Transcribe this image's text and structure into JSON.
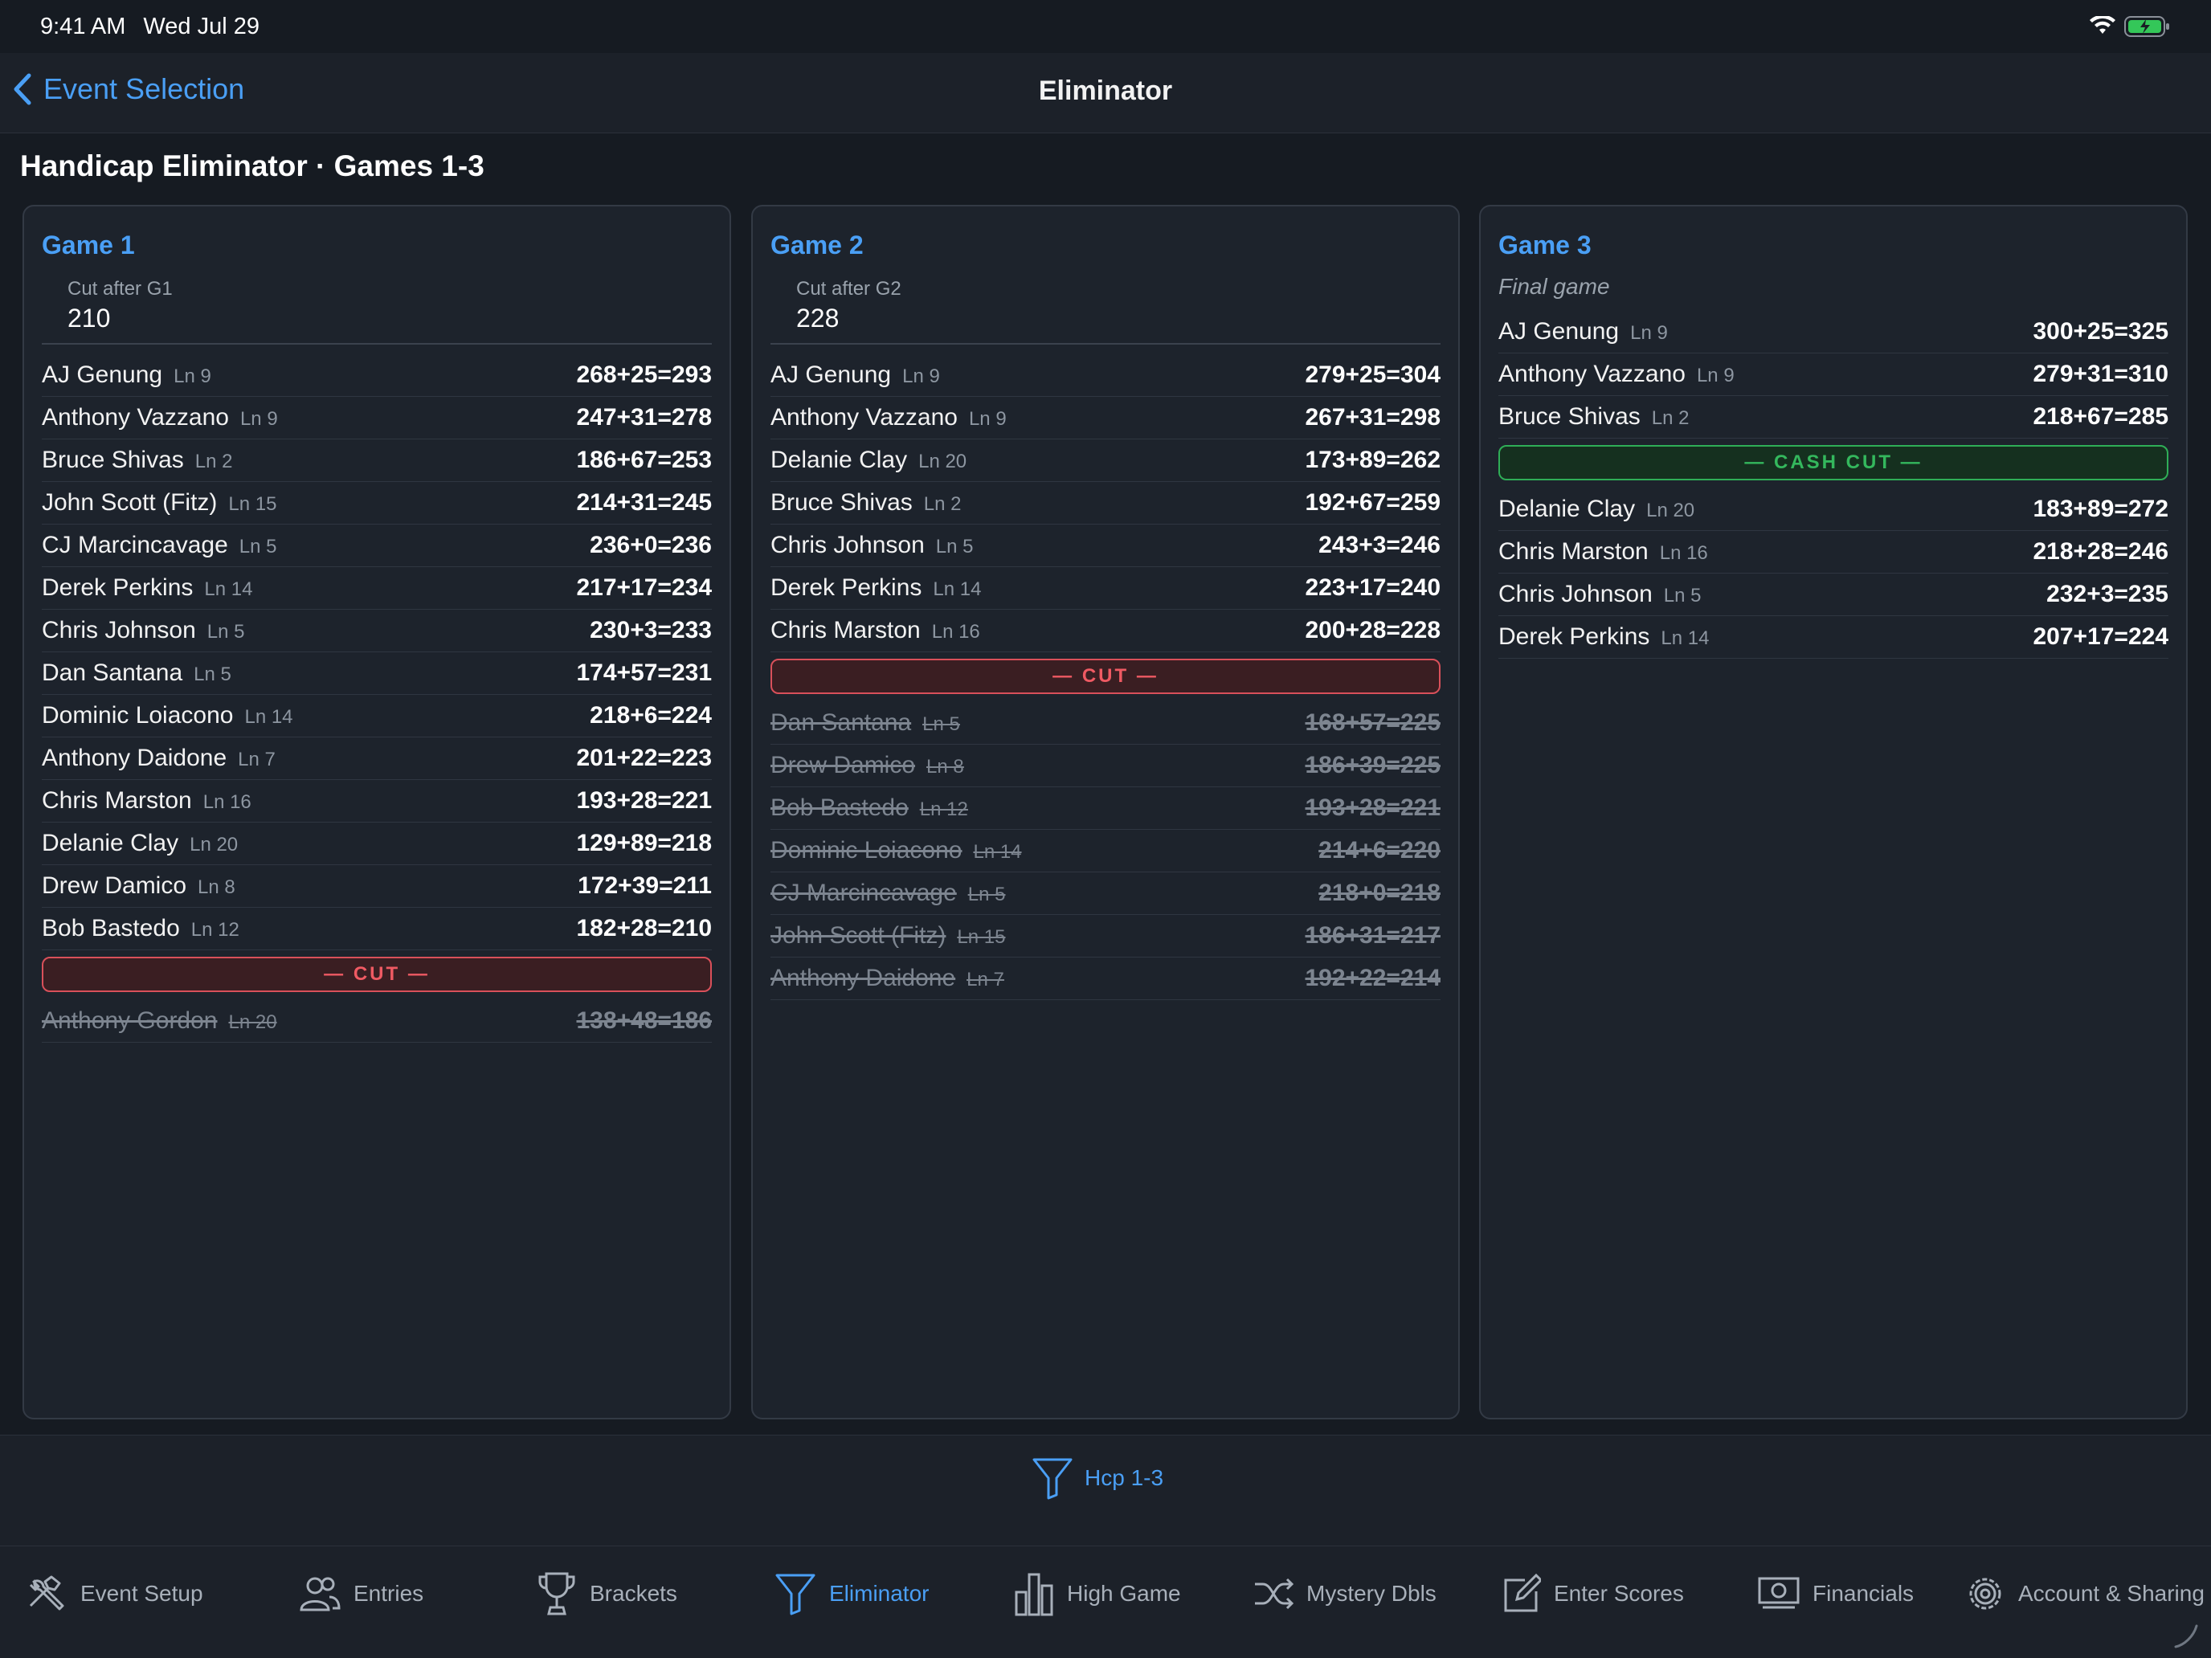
{
  "status": {
    "time": "9:41 AM",
    "date": "Wed Jul 29"
  },
  "nav": {
    "back_label": "Event Selection",
    "title": "Eliminator"
  },
  "heading": "Handicap Eliminator · Games 1-3",
  "colors": {
    "accent": "#4a9ff5",
    "cut": "#ef5a63",
    "cash": "#34b85d",
    "background": "#161b22"
  },
  "games": [
    {
      "title": "Game 1",
      "cut_label": "Cut after G1",
      "cut_value": "210",
      "divider_label": "— CUT —",
      "rows_in": [
        {
          "name": "AJ Genung",
          "lane": "Ln 9",
          "score": "268+25=293"
        },
        {
          "name": "Anthony Vazzano",
          "lane": "Ln 9",
          "score": "247+31=278"
        },
        {
          "name": "Bruce Shivas",
          "lane": "Ln 2",
          "score": "186+67=253"
        },
        {
          "name": "John Scott (Fitz)",
          "lane": "Ln 15",
          "score": "214+31=245"
        },
        {
          "name": "CJ Marcincavage",
          "lane": "Ln 5",
          "score": "236+0=236"
        },
        {
          "name": "Derek Perkins",
          "lane": "Ln 14",
          "score": "217+17=234"
        },
        {
          "name": "Chris Johnson",
          "lane": "Ln 5",
          "score": "230+3=233"
        },
        {
          "name": "Dan Santana",
          "lane": "Ln 5",
          "score": "174+57=231"
        },
        {
          "name": "Dominic Loiacono",
          "lane": "Ln 14",
          "score": "218+6=224"
        },
        {
          "name": "Anthony Daidone",
          "lane": "Ln 7",
          "score": "201+22=223"
        },
        {
          "name": "Chris Marston",
          "lane": "Ln 16",
          "score": "193+28=221"
        },
        {
          "name": "Delanie Clay",
          "lane": "Ln 20",
          "score": "129+89=218"
        },
        {
          "name": "Drew Damico",
          "lane": "Ln 8",
          "score": "172+39=211"
        },
        {
          "name": "Bob Bastedo",
          "lane": "Ln 12",
          "score": "182+28=210"
        }
      ],
      "rows_out": [
        {
          "name": "Anthony Gordon",
          "lane": "Ln 20",
          "score": "138+48=186"
        }
      ]
    },
    {
      "title": "Game 2",
      "cut_label": "Cut after G2",
      "cut_value": "228",
      "divider_label": "— CUT —",
      "rows_in": [
        {
          "name": "AJ Genung",
          "lane": "Ln 9",
          "score": "279+25=304"
        },
        {
          "name": "Anthony Vazzano",
          "lane": "Ln 9",
          "score": "267+31=298"
        },
        {
          "name": "Delanie Clay",
          "lane": "Ln 20",
          "score": "173+89=262"
        },
        {
          "name": "Bruce Shivas",
          "lane": "Ln 2",
          "score": "192+67=259"
        },
        {
          "name": "Chris Johnson",
          "lane": "Ln 5",
          "score": "243+3=246"
        },
        {
          "name": "Derek Perkins",
          "lane": "Ln 14",
          "score": "223+17=240"
        },
        {
          "name": "Chris Marston",
          "lane": "Ln 16",
          "score": "200+28=228"
        }
      ],
      "rows_out": [
        {
          "name": "Dan Santana",
          "lane": "Ln 5",
          "score": "168+57=225"
        },
        {
          "name": "Drew Damico",
          "lane": "Ln 8",
          "score": "186+39=225"
        },
        {
          "name": "Bob Bastedo",
          "lane": "Ln 12",
          "score": "193+28=221"
        },
        {
          "name": "Dominic Loiacono",
          "lane": "Ln 14",
          "score": "214+6=220"
        },
        {
          "name": "CJ Marcincavage",
          "lane": "Ln 5",
          "score": "218+0=218"
        },
        {
          "name": "John Scott (Fitz)",
          "lane": "Ln 15",
          "score": "186+31=217"
        },
        {
          "name": "Anthony Daidone",
          "lane": "Ln 7",
          "score": "192+22=214"
        }
      ]
    },
    {
      "title": "Game 3",
      "subtitle": "Final game",
      "divider_label": "— CASH CUT —",
      "rows_in": [
        {
          "name": "AJ Genung",
          "lane": "Ln 9",
          "score": "300+25=325"
        },
        {
          "name": "Anthony Vazzano",
          "lane": "Ln 9",
          "score": "279+31=310"
        },
        {
          "name": "Bruce Shivas",
          "lane": "Ln 2",
          "score": "218+67=285"
        }
      ],
      "rows_after": [
        {
          "name": "Delanie Clay",
          "lane": "Ln 20",
          "score": "183+89=272"
        },
        {
          "name": "Chris Marston",
          "lane": "Ln 16",
          "score": "218+28=246"
        },
        {
          "name": "Chris Johnson",
          "lane": "Ln 5",
          "score": "232+3=235"
        },
        {
          "name": "Derek Perkins",
          "lane": "Ln 14",
          "score": "207+17=224"
        }
      ]
    }
  ],
  "filter": {
    "label": "Hcp 1-3",
    "icon": "filter-icon"
  },
  "tabs": [
    {
      "label": "Event Setup",
      "icon": "hammer-wrench-icon"
    },
    {
      "label": "Entries",
      "icon": "people-icon"
    },
    {
      "label": "Brackets",
      "icon": "trophy-icon"
    },
    {
      "label": "Eliminator",
      "icon": "filter-icon",
      "active": true
    },
    {
      "label": "High Game",
      "icon": "bar-chart-icon"
    },
    {
      "label": "Mystery Dbls",
      "icon": "shuffle-icon"
    },
    {
      "label": "Enter Scores",
      "icon": "edit-icon"
    },
    {
      "label": "Financials",
      "icon": "money-icon"
    },
    {
      "label": "Account & Sharing",
      "icon": "gear-icon"
    }
  ]
}
